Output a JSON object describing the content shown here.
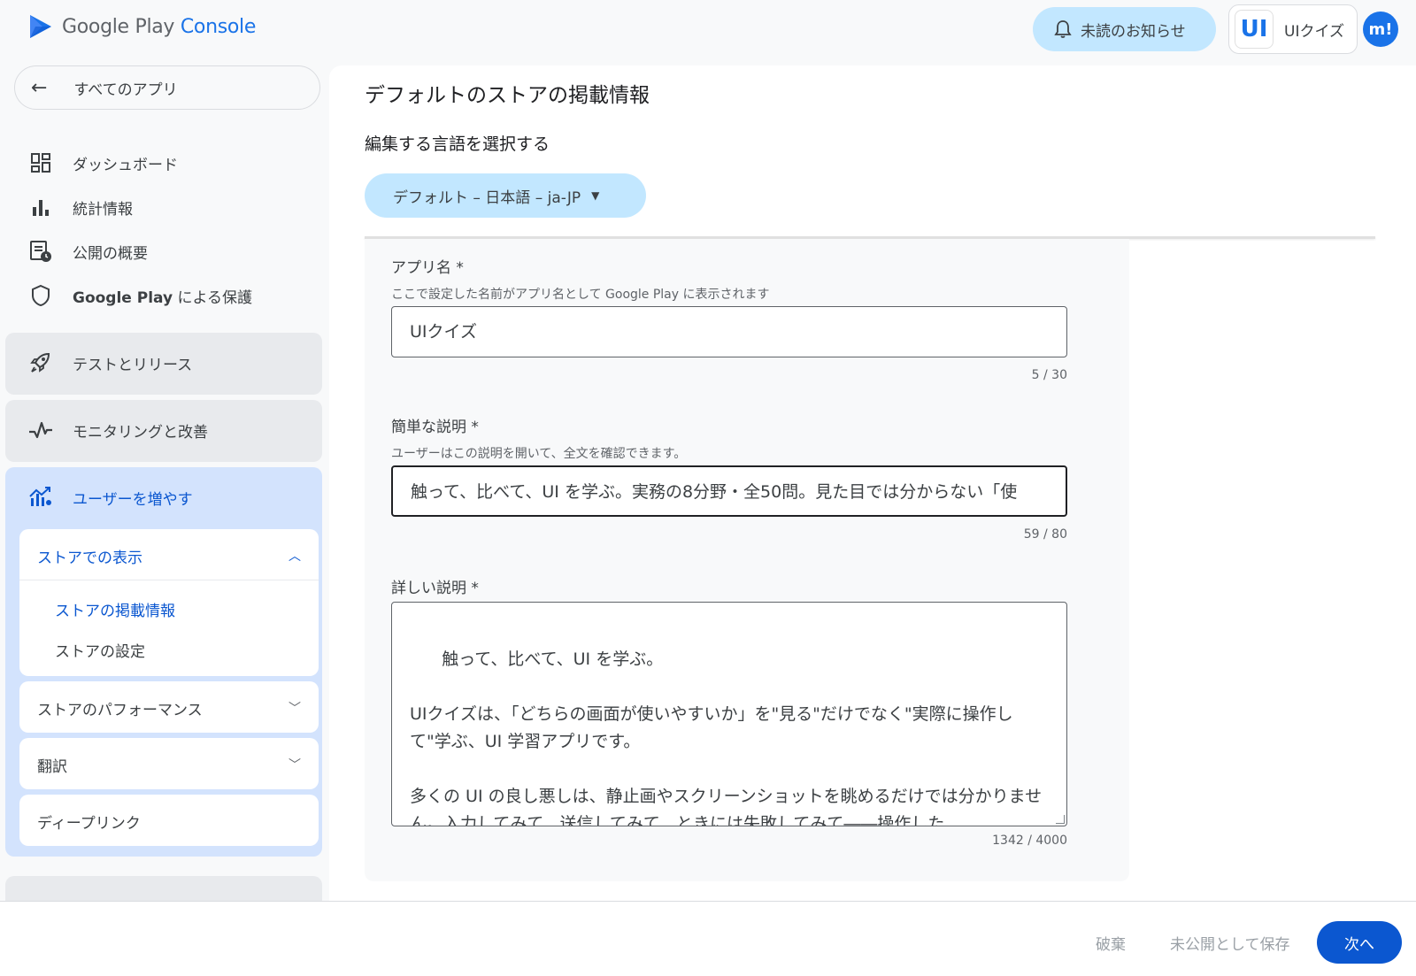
{
  "header": {
    "logo_google_play": "Google Play ",
    "logo_console": "Console",
    "notification_label": "未読のお知らせ",
    "app_icon_text": "UI",
    "app_name": "UIクイズ",
    "avatar_text": "m!"
  },
  "sidebar": {
    "all_apps": "すべてのアプリ",
    "items": [
      {
        "label": "ダッシュボード",
        "icon": "dashboard-icon"
      },
      {
        "label": "統計情報",
        "icon": "bar-chart-icon"
      },
      {
        "label": "公開の概要",
        "icon": "publishing-overview-icon"
      },
      {
        "label_bold": "Google Play",
        "label": " による保護",
        "icon": "shield-icon"
      }
    ],
    "sections": {
      "test_release": "テストとリリース",
      "monitoring": "モニタリングと改善",
      "grow_users": "ユーザーを増やす"
    },
    "store_presence": {
      "title": "ストアでの表示",
      "links": [
        "ストアの掲載情報",
        "ストアの設定"
      ]
    },
    "store_performance": "ストアのパフォーマンス",
    "translation": "翻訳",
    "deep_link": "ディープリンク"
  },
  "main": {
    "page_title": "デフォルトのストアの掲載情報",
    "language_label": "編集する言語を選択する",
    "language_value": "デフォルト – 日本語 – ja-JP",
    "fields": {
      "app_name": {
        "label": "アプリ名 *",
        "help": "ここで設定した名前がアプリ名として Google Play に表示されます",
        "value": "UIクイズ",
        "counter": "5 / 30"
      },
      "short_desc": {
        "label": "簡単な説明 *",
        "help": "ユーザーはこの説明を開いて、全文を確認できます。",
        "value": "触って、比べて、UI を学ぶ。実務の8分野・全50問。見た目では分からない「使",
        "counter": "59 / 80"
      },
      "full_desc": {
        "label": "詳しい説明 *",
        "value": "触って、比べて、UI を学ぶ。\n\nUIクイズは、「どちらの画面が使いやすいか」を\"見る\"だけでなく\"実際に操作して\"学ぶ、UI 学習アプリです。\n\n多くの UI の良し悪しは、静止画やスクリーンショットを眺めるだけでは分かりません。入力してみて、送信してみて、ときには失敗してみて――操作した",
        "counter": "1342 / 4000"
      }
    }
  },
  "footer": {
    "discard": "破棄",
    "save_draft": "未公開として保存",
    "next": "次へ"
  },
  "colors": {
    "accent": "#0b57d0",
    "chip_bg": "#c2e7ff",
    "active_section_bg": "#d3e3fd"
  }
}
